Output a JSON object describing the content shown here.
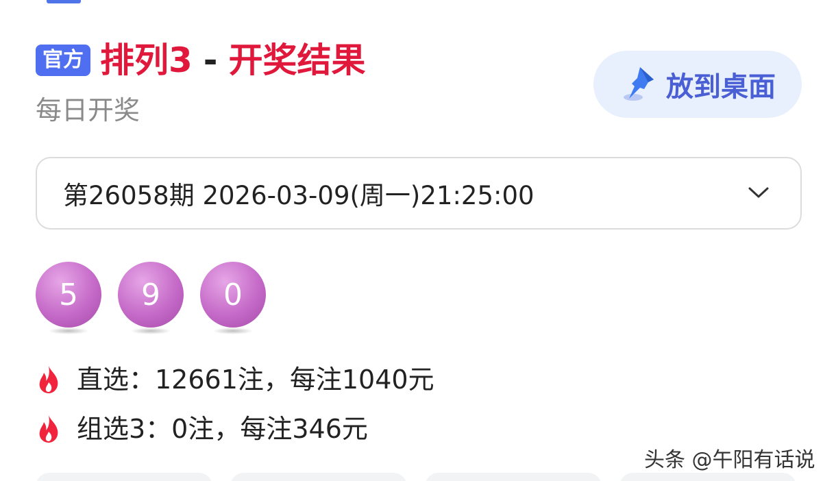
{
  "header": {
    "badge": "官方",
    "title_main": "排列3",
    "title_sep": "-",
    "title_sub": "开奖结果",
    "subtitle": "每日开奖"
  },
  "pin_button": {
    "label": "放到桌面",
    "icon": "pushpin-icon"
  },
  "issue": {
    "selected": "第26058期 2026-03-09(周一)21:25:00",
    "icon": "chevron-down-icon"
  },
  "balls": [
    "5",
    "9",
    "0"
  ],
  "prizes": [
    {
      "icon": "fire-icon",
      "text": "直选：12661注，每注1040元"
    },
    {
      "icon": "fire-icon",
      "text": "组选3：0注，每注346元"
    }
  ],
  "watermark": "头条 @午阳有话说",
  "colors": {
    "title_red": "#e0183c",
    "badge_blue": "#4f6ef0",
    "ball_purple": "#c56ac8",
    "fire_red": "#f0243c"
  }
}
